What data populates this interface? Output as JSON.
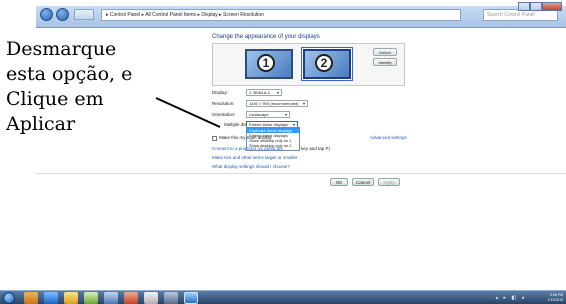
{
  "window": {
    "address_path": "▸ Control Panel ▸ All Control Panel Items ▸ Display ▸ Screen Resolution",
    "search_placeholder": "Search Control Panel"
  },
  "overlay": {
    "lines": [
      "Desmarque",
      "esta opção, e",
      "Clique em",
      "Aplicar"
    ]
  },
  "dialog": {
    "heading": "Change the appearance of your displays",
    "monitor_1": "1",
    "monitor_2": "2",
    "detect_label": "Detect",
    "identify_label": "Identify",
    "display_label": "Display:",
    "display_value": "2. BDBLA-1",
    "resolution_label": "Resolution:",
    "resolution_value": "1440 × 900 (recommended)",
    "orientation_label": "Orientation:",
    "orientation_value": "Landscape",
    "multiple_label": "Multiple displays:",
    "multiple_value": "Extend these displays",
    "multiple_options": [
      "Duplicate these displays",
      "Extend these displays",
      "Show desktop only on 1",
      "Show desktop only on 2"
    ],
    "main_display_label": "Make this my main display",
    "advanced_link": "Advanced settings",
    "projector_link": "Connect to a projector (or press the",
    "projector_suffix": "key and tap P)",
    "text_size_link": "Make text and other items larger or smaller",
    "which_settings_link": "What display settings should I choose?",
    "ok_label": "OK",
    "cancel_label": "Cancel",
    "apply_label": "Apply"
  },
  "taskbar": {
    "time": "3:08 PM",
    "date": "1/11/2013"
  },
  "colors": {
    "link": "#1e5bb8",
    "heading": "#1e3d8f",
    "highlight": "#3399ff"
  }
}
